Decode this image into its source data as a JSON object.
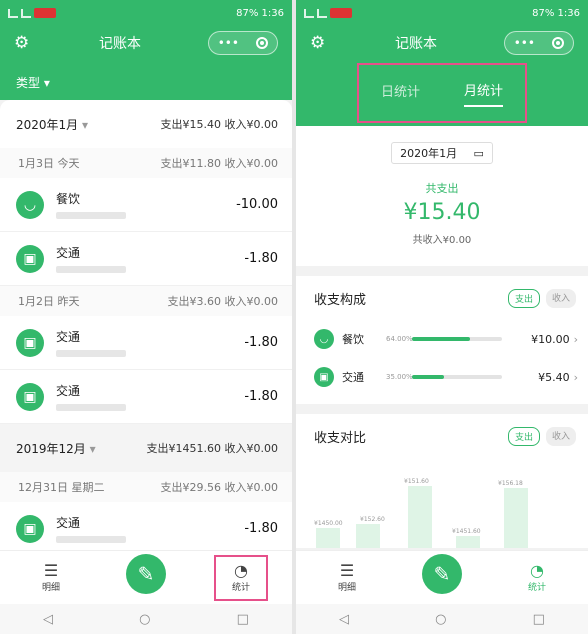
{
  "status": {
    "time": "1:36",
    "battery": "87%"
  },
  "app": {
    "title": "记账本",
    "capsule_more": "•••"
  },
  "left": {
    "filter_label": "类型",
    "months": [
      {
        "label": "2020年1月",
        "expense": "支出¥15.40",
        "income": "收入¥0.00"
      },
      {
        "label": "2019年12月",
        "expense": "支出¥1451.60",
        "income": "收入¥0.00"
      }
    ],
    "days": [
      {
        "label": "1月3日 今天",
        "expense": "支出¥11.80",
        "income": "收入¥0.00"
      },
      {
        "label": "1月2日 昨天",
        "expense": "支出¥3.60",
        "income": "收入¥0.00"
      },
      {
        "label": "12月31日 星期二",
        "expense": "支出¥29.56",
        "income": "收入¥0.00"
      }
    ],
    "entries": [
      {
        "name": "餐饮",
        "amount": "-10.00"
      },
      {
        "name": "交通",
        "amount": "-1.80"
      },
      {
        "name": "交通",
        "amount": "-1.80"
      },
      {
        "name": "交通",
        "amount": "-1.80"
      },
      {
        "name": "交通",
        "amount": "-1.80"
      }
    ]
  },
  "nav": {
    "detail": "明细",
    "stats": "统计"
  },
  "right": {
    "tabs": {
      "day": "日统计",
      "month": "月统计"
    },
    "date": "2020年1月",
    "summary": {
      "label": "共支出",
      "amount": "¥15.40",
      "income": "共收入¥0.00"
    },
    "composition": {
      "title": "收支构成",
      "toggle_expense": "支出",
      "toggle_income": "收入",
      "items": [
        {
          "name": "餐饮",
          "percent": "64.00%",
          "fill": 0.64,
          "amount": "¥10.00"
        },
        {
          "name": "交通",
          "percent": "35.00%",
          "fill": 0.35,
          "amount": "¥5.40"
        }
      ]
    },
    "comparison": {
      "title": "收支对比",
      "toggle_expense": "支出",
      "toggle_income": "收入",
      "bar_labels": [
        "¥1450.00",
        "¥152.60",
        "¥151.60",
        "¥1451.60",
        "¥156.18"
      ]
    }
  },
  "colors": {
    "accent": "#33b86b",
    "highlight": "#e6508a"
  }
}
